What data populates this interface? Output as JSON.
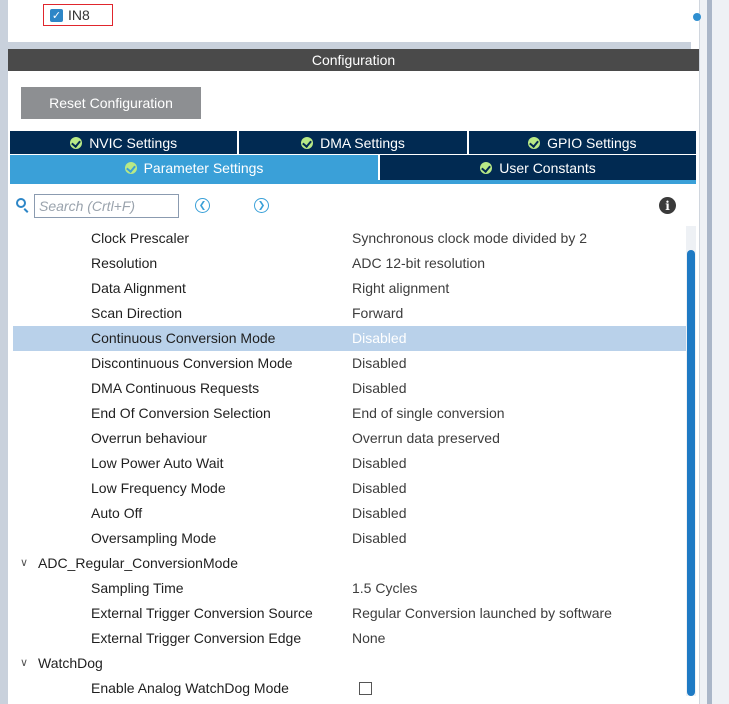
{
  "input_channel": {
    "label": "IN8",
    "checked": true
  },
  "config": {
    "title": "Configuration",
    "reset_label": "Reset Configuration"
  },
  "tabs": {
    "row1": [
      {
        "label": "NVIC Settings"
      },
      {
        "label": "DMA Settings"
      },
      {
        "label": "GPIO Settings"
      }
    ],
    "row2": [
      {
        "label": "Parameter Settings",
        "active": true
      },
      {
        "label": "User Constants"
      }
    ]
  },
  "search": {
    "placeholder": "Search (Crtl+F)"
  },
  "params": {
    "rows": [
      {
        "name": "Clock Prescaler",
        "value": "Synchronous clock mode divided by 2"
      },
      {
        "name": "Resolution",
        "value": "ADC 12-bit resolution"
      },
      {
        "name": "Data Alignment",
        "value": "Right alignment"
      },
      {
        "name": "Scan Direction",
        "value": "Forward"
      },
      {
        "name": "Continuous Conversion Mode",
        "value": "Disabled"
      },
      {
        "name": "Discontinuous Conversion Mode",
        "value": "Disabled"
      },
      {
        "name": "DMA Continuous Requests",
        "value": "Disabled"
      },
      {
        "name": "End Of Conversion Selection",
        "value": "End of single conversion"
      },
      {
        "name": "Overrun behaviour",
        "value": "Overrun data preserved"
      },
      {
        "name": "Low Power Auto Wait",
        "value": "Disabled"
      },
      {
        "name": "Low Frequency Mode",
        "value": "Disabled"
      },
      {
        "name": "Auto Off",
        "value": "Disabled"
      },
      {
        "name": "Oversampling Mode",
        "value": "Disabled"
      }
    ],
    "group_regular": "ADC_Regular_ConversionMode",
    "regular_rows": [
      {
        "name": "Sampling Time",
        "value": "1.5 Cycles"
      },
      {
        "name": "External Trigger Conversion Source",
        "value": "Regular Conversion launched by software"
      },
      {
        "name": "External Trigger Conversion Edge",
        "value": "None"
      }
    ],
    "group_watchdog": "WatchDog",
    "watchdog_rows": [
      {
        "name": "Enable Analog WatchDog Mode",
        "checked": false
      }
    ]
  },
  "colors": {
    "tab_dark": "#012a52",
    "tab_active": "#3aa0d8",
    "selected_row": "#b9d1ea",
    "header": "#4a4a4a",
    "reset_button": "#8d8f92",
    "highlight_border": "#e0262d"
  }
}
